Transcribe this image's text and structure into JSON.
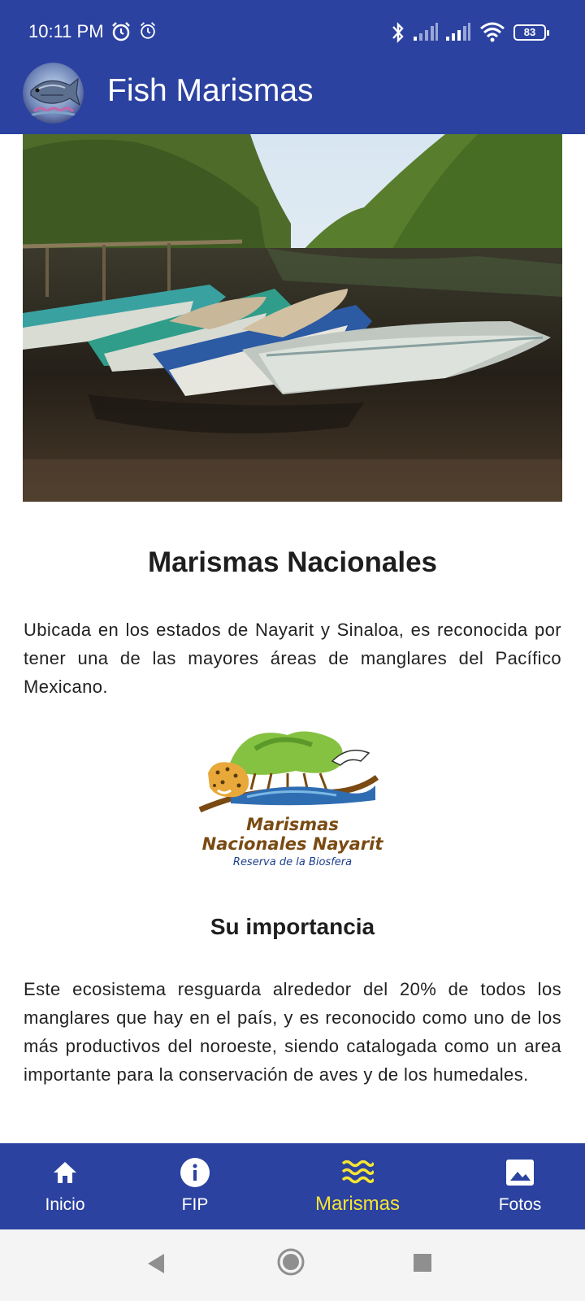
{
  "status_bar": {
    "time": "10:11 PM",
    "battery": "83",
    "icons": [
      "alarm-icon",
      "alarm-outline-icon",
      "bluetooth-icon",
      "signal-icon",
      "signal-icon",
      "wifi-icon",
      "battery-icon"
    ]
  },
  "app_bar": {
    "title": "Fish Marismas",
    "logo_icon": "fish-logo-icon"
  },
  "content": {
    "heading": "Marismas Nacionales",
    "intro": "Ubicada en los estados de Nayarit y Sinaloa, es reconocida por tener una de las mayores áreas de manglares del Pacífico Mexicano.",
    "badge": {
      "line1": "Marismas",
      "line2": "Nacionales Nayarit",
      "line3": "Reserva de la Biosfera"
    },
    "subheading": "Su importancia",
    "importance": "Este ecosistema resguarda alrededor del 20% de todos los manglares que hay en el país, y es reconocido como uno de los más productivos del noroeste, siendo catalogada como un area importante para la conservación de aves y de los humedales."
  },
  "bottom_nav": {
    "items": [
      {
        "label": "Inicio",
        "icon": "home-icon"
      },
      {
        "label": "FIP",
        "icon": "info-icon"
      },
      {
        "label": "Marismas",
        "icon": "waves-icon",
        "active": true
      },
      {
        "label": "Fotos",
        "icon": "image-icon"
      }
    ]
  },
  "colors": {
    "primary": "#2b42a0",
    "active_nav": "#f7e532",
    "text": "#212121"
  }
}
